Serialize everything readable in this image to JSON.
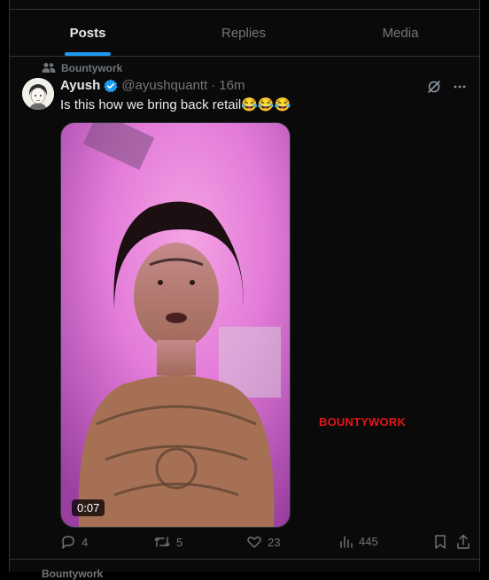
{
  "tabs": [
    {
      "label": "Posts",
      "active": true
    },
    {
      "label": "Replies",
      "active": false
    },
    {
      "label": "Media",
      "active": false
    }
  ],
  "post": {
    "community": "Bountywork",
    "author_name": "Ayush",
    "handle": "@ayushquantt",
    "separator": "·",
    "time": "16m",
    "text": "Is this how we bring back retail😂😂😂",
    "video_duration": "0:07",
    "watermark": "BOUNTYWORK",
    "stats": {
      "replies": "4",
      "reposts": "5",
      "likes": "23",
      "views": "445"
    },
    "icons": {
      "community": "people-icon",
      "verified": "verified-badge-icon",
      "grok": "grok-icon",
      "more": "more-icon",
      "reply": "reply-icon",
      "repost": "repost-icon",
      "like": "heart-icon",
      "views": "views-icon",
      "bookmark": "bookmark-icon",
      "share": "share-icon"
    }
  },
  "next_post": {
    "community": "Bountywork"
  },
  "colors": {
    "accent": "#1d9bf0",
    "watermark": "#e0161a",
    "muted": "#71767b",
    "text": "#e7e9ea"
  }
}
